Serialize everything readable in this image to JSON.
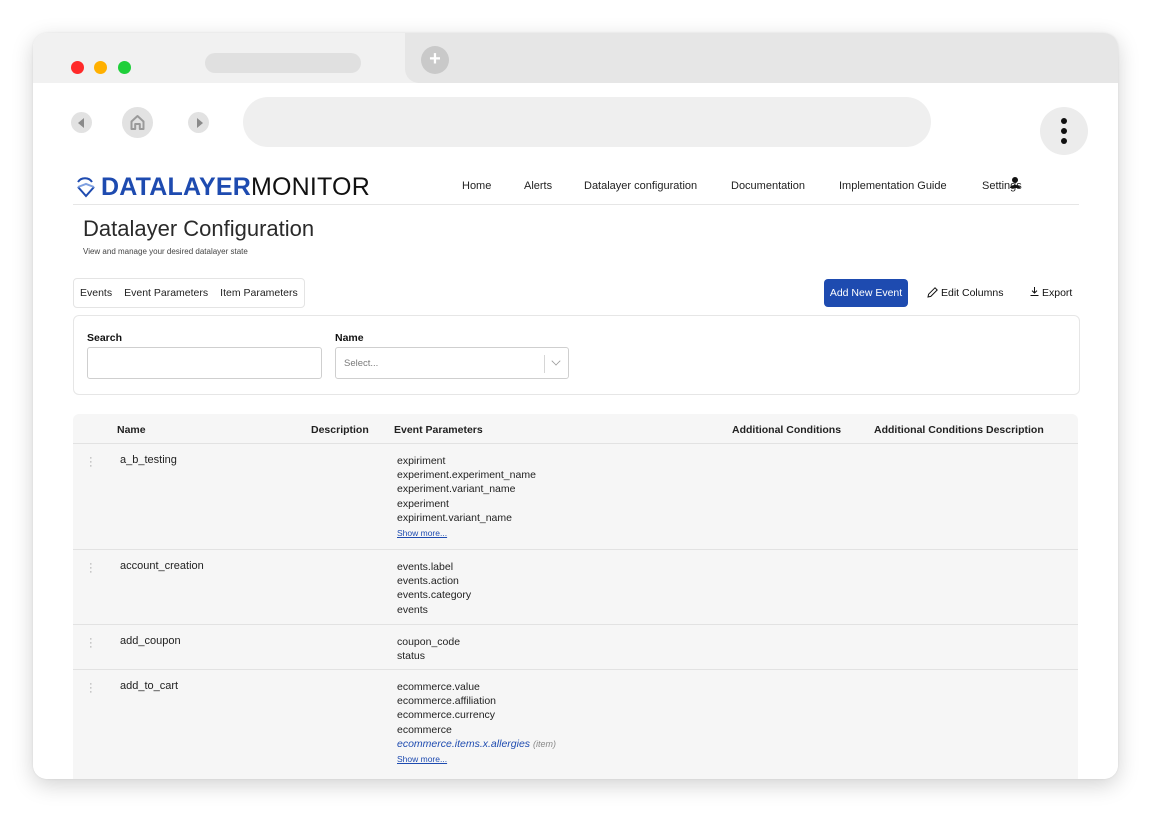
{
  "browser": {
    "new_tab_icon": "plus-icon",
    "colors": {
      "close": "#ff2a2a",
      "minimize": "#ffb000",
      "maximize": "#1fcf3a"
    }
  },
  "header": {
    "logo_strong": "DATALAYER",
    "logo_light": "MONITOR",
    "nav": [
      "Home",
      "Alerts",
      "Datalayer configuration",
      "Documentation",
      "Implementation Guide",
      "Settings"
    ],
    "user_icon": "person-icon"
  },
  "page": {
    "title": "Datalayer Configuration",
    "subtitle": "View and manage your desired datalayer state"
  },
  "tabs": [
    "Events",
    "Event Parameters",
    "Item Parameters"
  ],
  "toolbar": {
    "add_label": "Add New Event",
    "edit_label": "Edit Columns",
    "export_label": "Export"
  },
  "filters": {
    "search_label": "Search",
    "search_value": "",
    "name_label": "Name",
    "name_placeholder": "Select..."
  },
  "table": {
    "columns": [
      "Name",
      "Description",
      "Event Parameters",
      "Additional Conditions",
      "Additional Conditions Description"
    ],
    "show_more": "Show more...",
    "item_tag": "(item)",
    "rows": [
      {
        "name": "a_b_testing",
        "params": [
          "expiriment",
          "experiment.experiment_name",
          "experiment.variant_name",
          "experiment",
          "expiriment.variant_name"
        ]
      },
      {
        "name": "account_creation",
        "params": [
          "events.label",
          "events.action",
          "events.category",
          "events"
        ]
      },
      {
        "name": "add_coupon",
        "params": [
          "coupon_code",
          "status"
        ]
      },
      {
        "name": "add_to_cart",
        "params": [
          "ecommerce.value",
          "ecommerce.affiliation",
          "ecommerce.currency",
          "ecommerce"
        ],
        "item_param": "ecommerce.items.x.allergies"
      }
    ]
  },
  "accent_color": "#1e4bb0"
}
